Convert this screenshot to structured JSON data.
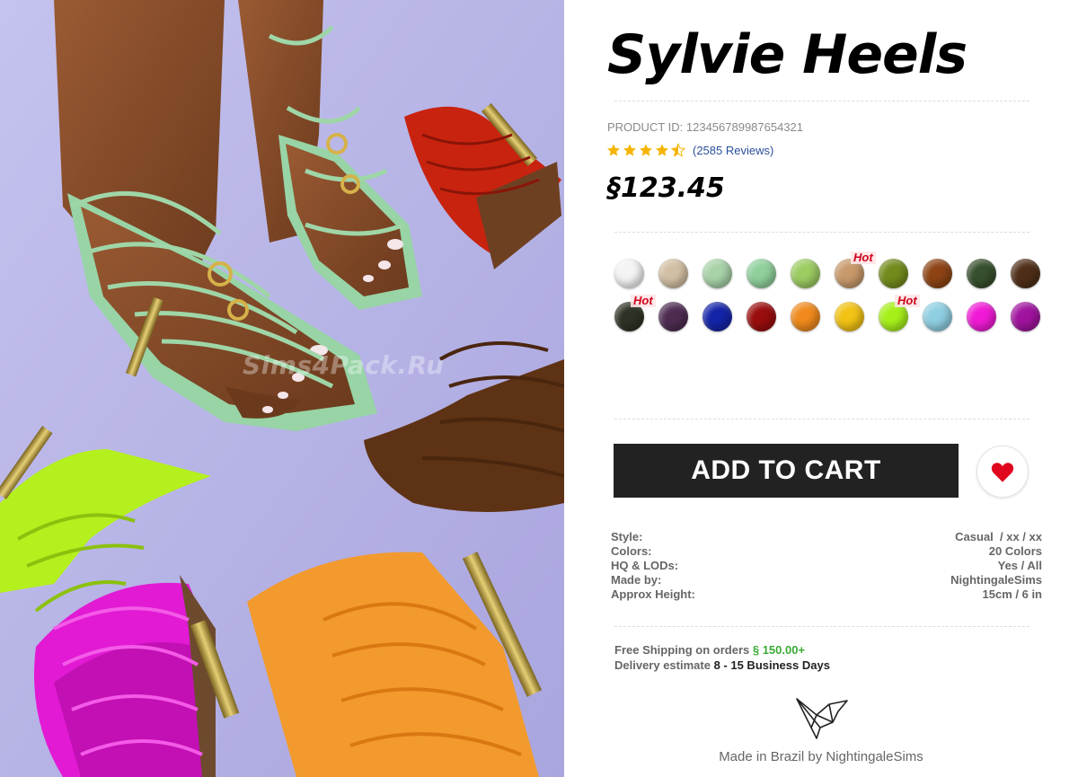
{
  "product": {
    "title": "Sylvie Heels",
    "product_id_label": "PRODUCT ID: 123456789987654321",
    "rating": 4.5,
    "reviews": "(2585 Reviews)",
    "price": "§123.45",
    "image_watermark": "Sims4Pack.Ru"
  },
  "swatches": {
    "hot_label": "Hot",
    "rows": [
      [
        {
          "color": "#f4f4f4",
          "hot": false
        },
        {
          "color": "#d2bfa3",
          "hot": false
        },
        {
          "color": "#a8d2a8",
          "hot": false
        },
        {
          "color": "#8fd09c",
          "hot": false
        },
        {
          "color": "#9ccc62",
          "hot": false
        },
        {
          "color": "#c8996b",
          "hot": true
        },
        {
          "color": "#738b1c",
          "hot": false
        },
        {
          "color": "#8d4314",
          "hot": false
        },
        {
          "color": "#364f2c",
          "hot": false
        },
        {
          "color": "#4f2e18",
          "hot": false
        }
      ],
      [
        {
          "color": "#2e3224",
          "hot": true
        },
        {
          "color": "#4e2c52",
          "hot": false
        },
        {
          "color": "#1424a8",
          "hot": false
        },
        {
          "color": "#9a0d0d",
          "hot": false
        },
        {
          "color": "#f08a1c",
          "hot": false
        },
        {
          "color": "#f2c214",
          "hot": false
        },
        {
          "color": "#a6f01a",
          "hot": true
        },
        {
          "color": "#8fcfe2",
          "hot": false
        },
        {
          "color": "#f01ad6",
          "hot": false
        },
        {
          "color": "#a0139e",
          "hot": false
        }
      ]
    ]
  },
  "actions": {
    "add_to_cart": "ADD TO CART",
    "wishlist_icon": "heart-icon"
  },
  "specs": [
    {
      "label": "Style:",
      "value": "Casual  / xx / xx"
    },
    {
      "label": "Colors:",
      "value": "20 Colors"
    },
    {
      "label": "HQ & LODs:",
      "value": "Yes / All"
    },
    {
      "label": "Made by:",
      "value": "NightingaleSims"
    },
    {
      "label": "Approx Height:",
      "value": "15cm / 6 in"
    }
  ],
  "shipping": {
    "line1_prefix": "Free Shipping on orders ",
    "line1_amount": "§ 150.00+",
    "line2_prefix": "Delivery estimate ",
    "line2_days": "8 - 15 Business Days"
  },
  "footer": {
    "text": "Made in Brazil by NightingaleSims",
    "logo_icon": "origami-bird-icon"
  },
  "colors": {
    "accent_dark": "#222222",
    "heart": "#e0061d",
    "star": "#f5b400",
    "link": "#2a4f9e",
    "green": "#3aaa35",
    "background_lavender": "#b9b6e6"
  }
}
